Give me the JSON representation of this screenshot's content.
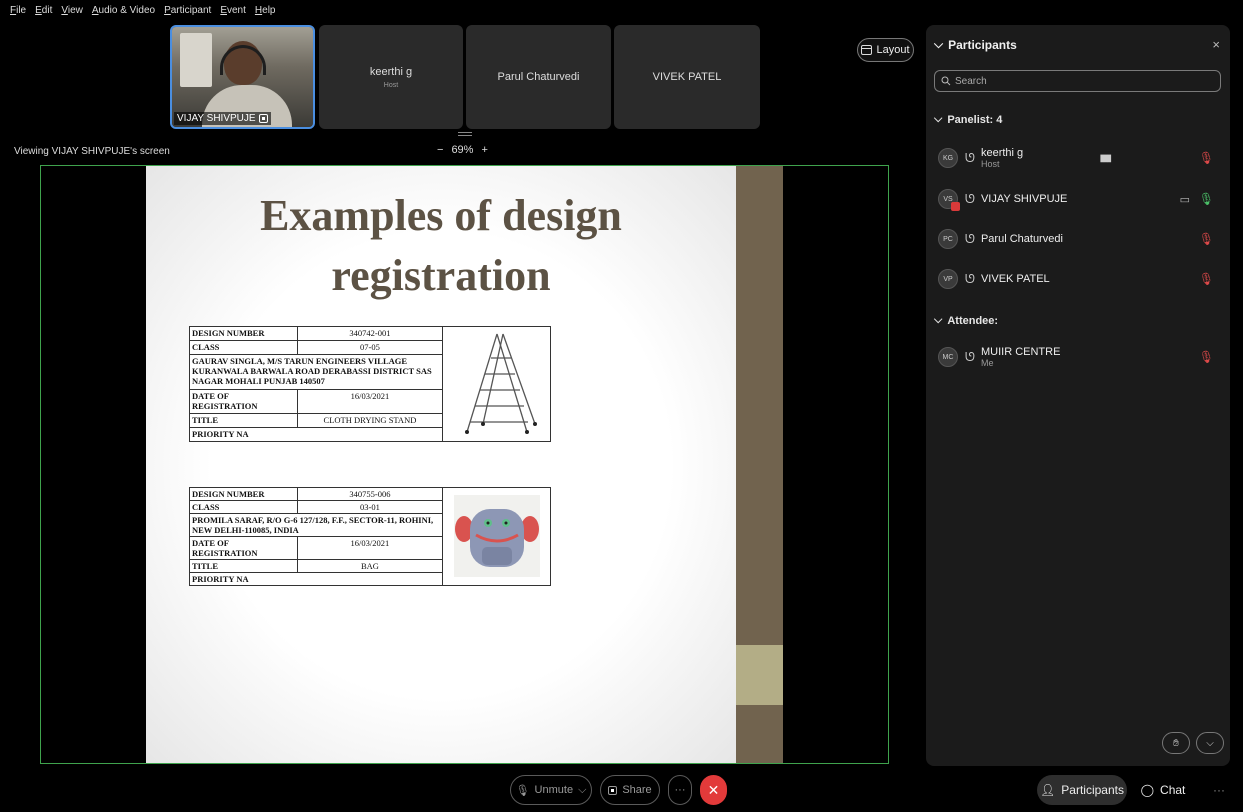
{
  "menu": [
    "File",
    "Edit",
    "View",
    "Audio & Video",
    "Participant",
    "Event",
    "Help"
  ],
  "video_strip": {
    "active_speaker": "VIJAY SHIVPUJE",
    "tiles": [
      {
        "name": "keerthi g",
        "role": "Host"
      },
      {
        "name": "Parul Chaturvedi",
        "role": ""
      },
      {
        "name": "VIVEK PATEL",
        "role": ""
      }
    ]
  },
  "layout_label": "Layout",
  "viewing_label": "Viewing VIJAY SHIVPUJE's screen",
  "zoom": {
    "minus": "−",
    "level": "69%",
    "plus": "+"
  },
  "slide": {
    "title_line1": "Examples of design",
    "title_line2": "registration",
    "table1": {
      "design_number_label": "DESIGN NUMBER",
      "design_number": "340742-001",
      "class_label": "CLASS",
      "class": "07-05",
      "applicant": "GAURAV SINGLA, M/S TARUN ENGINEERS VILLAGE KURANWALA BARWALA ROAD DERABASSI DISTRICT SAS NAGAR MOHALI PUNJAB 140507",
      "date_label": "DATE OF REGISTRATION",
      "date": "16/03/2021",
      "title_label": "TITLE",
      "title": "CLOTH DRYING STAND",
      "priority": "PRIORITY NA"
    },
    "table2": {
      "design_number_label": "DESIGN NUMBER",
      "design_number": "340755-006",
      "class_label": "CLASS",
      "class": "03-01",
      "applicant": "PROMILA SARAF, R/O G-6 127/128, F.F., SECTOR-11, ROHINI, NEW DELHI-110085, INDIA",
      "date_label": "DATE OF REGISTRATION",
      "date": "16/03/2021",
      "title_label": "TITLE",
      "title": "BAG",
      "priority": "PRIORITY NA"
    }
  },
  "participants_panel": {
    "title": "Participants",
    "close": "×",
    "search_placeholder": "Search",
    "panelist_header": "Panelist: 4",
    "attendee_header": "Attendee:",
    "panelists": [
      {
        "initials": "KG",
        "name": "keerthi g",
        "role": "Host",
        "mic": "muted",
        "speaking": true
      },
      {
        "initials": "VS",
        "name": "VIJAY SHIVPUJE",
        "role": "",
        "mic": "on",
        "sharing": true
      },
      {
        "initials": "PC",
        "name": "Parul Chaturvedi",
        "role": "",
        "mic": "muted"
      },
      {
        "initials": "VP",
        "name": "VIVEK PATEL",
        "role": "",
        "mic": "muted"
      }
    ],
    "attendees": [
      {
        "initials": "MC",
        "name": "MUIIR CENTRE",
        "role": "Me",
        "mic": "muted"
      }
    ]
  },
  "controls": {
    "unmute": "Unmute",
    "share": "Share",
    "more": "···",
    "participants": "Participants",
    "chat": "Chat",
    "overflow": "···"
  },
  "colors": {
    "accent": "#4a8ee0",
    "share_border": "#3fa34d",
    "end_call": "#e23a3a",
    "slide_title": "#5c5244"
  }
}
